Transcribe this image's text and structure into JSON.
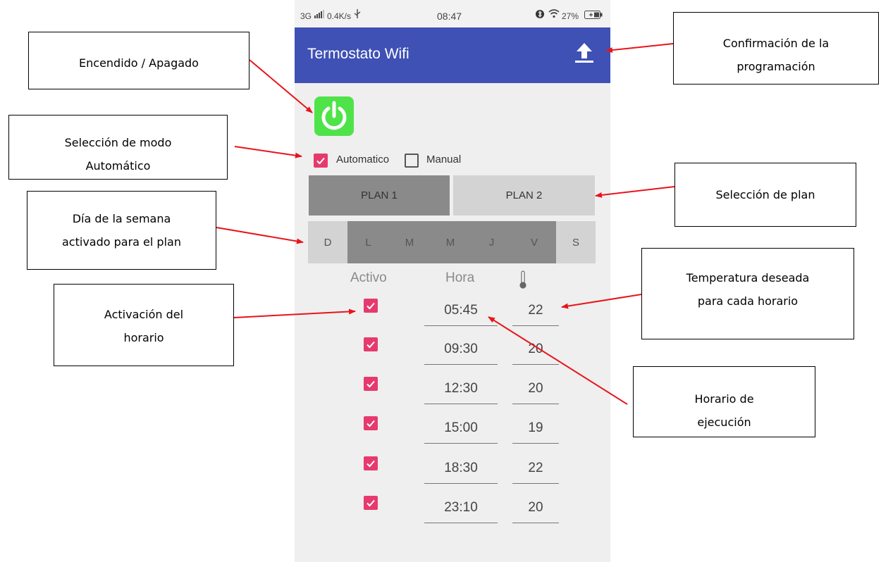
{
  "annotations": [
    {
      "id": "encendido",
      "lines": [
        "Encendido / Apagado"
      ]
    },
    {
      "id": "modo",
      "lines": [
        "Selección de modo",
        "Automático"
      ]
    },
    {
      "id": "dia",
      "lines": [
        "Día de la semana",
        "activado para el plan"
      ]
    },
    {
      "id": "activacion",
      "lines": [
        "Activación del",
        "horario"
      ]
    },
    {
      "id": "confirmacion",
      "lines": [
        "Confirmación de la",
        "programación"
      ]
    },
    {
      "id": "plan",
      "lines": [
        "Selección de plan"
      ]
    },
    {
      "id": "temperatura",
      "lines": [
        "Temperatura deseada",
        "para cada horario"
      ]
    },
    {
      "id": "ejecucion",
      "lines": [
        "Horario de",
        "ejecución"
      ]
    }
  ],
  "status_bar": {
    "network": "3G",
    "speed": "0.4K/s",
    "time": "08:47",
    "battery": "27%"
  },
  "app_bar": {
    "title": "Termostato Wifi",
    "action_icon": "upload-icon"
  },
  "power_button": {
    "icon": "power-icon",
    "color": "#4fe34a"
  },
  "mode": {
    "automatico": {
      "label": "Automatico",
      "checked": true
    },
    "manual": {
      "label": "Manual",
      "checked": false
    }
  },
  "plans": [
    {
      "label": "PLAN 1",
      "selected": true
    },
    {
      "label": "PLAN 2",
      "selected": false
    }
  ],
  "days": [
    {
      "label": "D",
      "active": false
    },
    {
      "label": "L",
      "active": true
    },
    {
      "label": "M",
      "active": true
    },
    {
      "label": "M",
      "active": true
    },
    {
      "label": "J",
      "active": true
    },
    {
      "label": "V",
      "active": true
    },
    {
      "label": "S",
      "active": false
    }
  ],
  "schedule_headers": {
    "active": "Activo",
    "time": "Hora",
    "temp_icon": "thermometer-icon"
  },
  "schedule": [
    {
      "active": true,
      "time": "05:45",
      "temp": "22"
    },
    {
      "active": true,
      "time": "09:30",
      "temp": "20"
    },
    {
      "active": true,
      "time": "12:30",
      "temp": "20"
    },
    {
      "active": true,
      "time": "15:00",
      "temp": "19"
    },
    {
      "active": true,
      "time": "18:30",
      "temp": "22"
    },
    {
      "active": true,
      "time": "23:10",
      "temp": "20"
    }
  ],
  "colors": {
    "app_bar": "#3f51b5",
    "checkbox_accent": "#e63a6f",
    "power": "#4fe34a",
    "arrow": "#e8141b",
    "plan_selected": "#8a8a8a",
    "plan_unselected": "#d3d3d3",
    "day_active": "#8a8a8a",
    "day_inactive": "#d3d3d3"
  }
}
